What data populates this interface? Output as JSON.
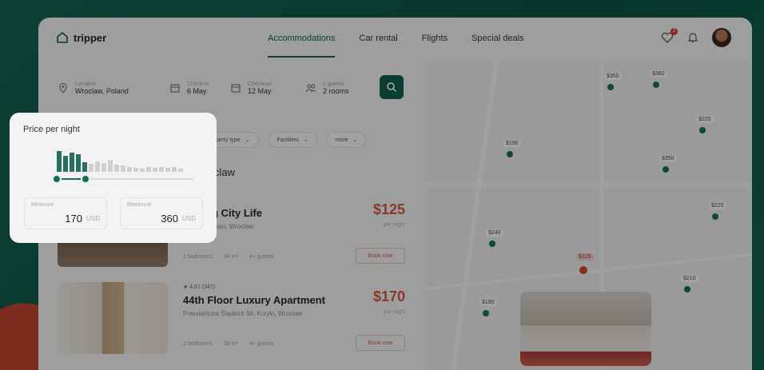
{
  "app": {
    "name": "tripper"
  },
  "nav": {
    "items": [
      "Accommodations",
      "Car rental",
      "Flights",
      "Special deals"
    ],
    "active_index": 0
  },
  "header": {
    "notification_count": "2"
  },
  "search": {
    "location": {
      "label": "Location",
      "value": "Wroclaw, Poland"
    },
    "checkin": {
      "label": "Check-in",
      "value": "6 May"
    },
    "checkout": {
      "label": "Checkout",
      "value": "12 May"
    },
    "guests": {
      "label": "2 guests",
      "value": "2 rooms"
    }
  },
  "filters": [
    "Property type",
    "Facilities",
    "more"
  ],
  "results": {
    "title": "claw"
  },
  "listings": [
    {
      "rating": "",
      "name": "ent Big City Life",
      "address": "a 22, Old Town, Wroclaw",
      "specs": [
        "2 bedrooms",
        "34 m²",
        "4+ guests"
      ],
      "price": "$125",
      "per_night": "per night",
      "book": "Book now"
    },
    {
      "rating": "★ 4.81 (347)",
      "name": "44th Floor Luxury Apartment",
      "address": "Powstańców Śląskich 96, Krzyki, Wroclaw",
      "specs": [
        "2 bedrooms",
        "38 m²",
        "4+ guests"
      ],
      "price": "$170",
      "per_night": "per night",
      "book": "Book now"
    }
  ],
  "map": {
    "pins": [
      {
        "label": "$350"
      },
      {
        "label": "$360"
      },
      {
        "label": "$190"
      },
      {
        "label": "$220"
      },
      {
        "label": "$350"
      },
      {
        "label": "$225"
      },
      {
        "label": "$240"
      },
      {
        "label": "$125",
        "selected": true
      },
      {
        "label": "$210"
      },
      {
        "label": "$190"
      }
    ]
  },
  "price_filter": {
    "title": "Price per night",
    "min_label": "Minimum",
    "min_value": "170",
    "max_label": "Maximum",
    "max_value": "360",
    "currency": "USD"
  },
  "colors": {
    "accent": "#0f5a4b",
    "price": "#c8553f",
    "selected_pin": "#cf3d30"
  }
}
